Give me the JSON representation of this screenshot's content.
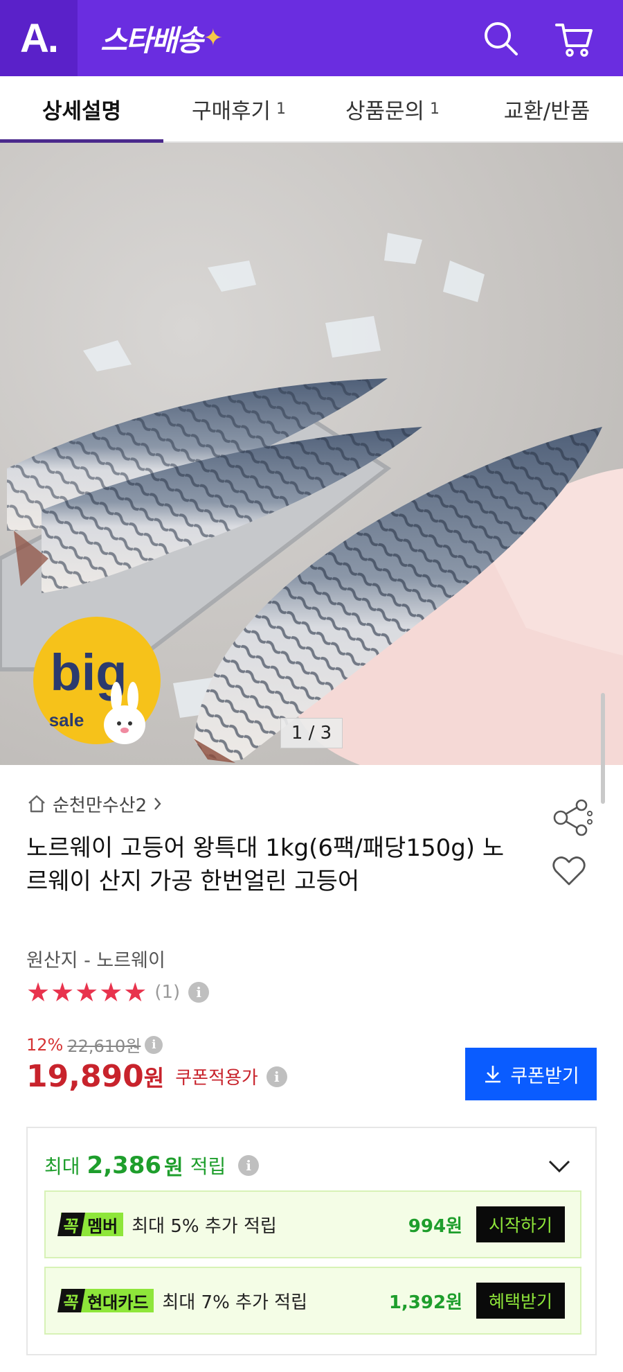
{
  "header": {
    "logo_text": "A.",
    "brand_text": "스타배송",
    "brand_star": "✦",
    "bg_color": "#6a2de0",
    "icons": [
      "search-icon",
      "cart-icon"
    ]
  },
  "tabs": [
    {
      "label": "상세설명",
      "count": ""
    },
    {
      "label": "구매후기",
      "count": "1"
    },
    {
      "label": "상품문의",
      "count": "1"
    },
    {
      "label": "교환/반품",
      "count": ""
    }
  ],
  "hero": {
    "badge_big": "big",
    "badge_sale": "sale",
    "pager": "1 / 3"
  },
  "product": {
    "seller": "순천만수산2",
    "title": "노르웨이 고등어 왕특대 1kg(6팩/패당150g) 노르웨이 산지 가공 한번얼린 고등어",
    "origin": "원산지 - 노르웨이",
    "rating_stars": 5,
    "review_count": "(1)",
    "discount_rate": "12%",
    "original_price": "22,610원",
    "price": "19,890",
    "price_unit": "원",
    "coupon_note": "쿠폰적용가",
    "coupon_button": "쿠폰받기"
  },
  "reward": {
    "prefix": "최대",
    "amount": "2,386",
    "unit": "원",
    "suffix": "적립",
    "benefits": [
      {
        "tag_prefix": "꼭",
        "tag_name": "멤버",
        "desc": "최대 5% 추가 적립",
        "amount": "994원",
        "button": "시작하기"
      },
      {
        "tag_prefix": "꼭",
        "tag_name": "현대카드",
        "desc": "최대 7% 추가 적립",
        "amount": "1,392원",
        "button": "혜택받기"
      }
    ]
  },
  "colors": {
    "brand_purple": "#6a2de0",
    "price_red": "#c8232c",
    "star_red": "#e8334d",
    "coupon_blue": "#0a5cff",
    "reward_green": "#1e9e2c",
    "tag_lime": "#8ee63a"
  }
}
